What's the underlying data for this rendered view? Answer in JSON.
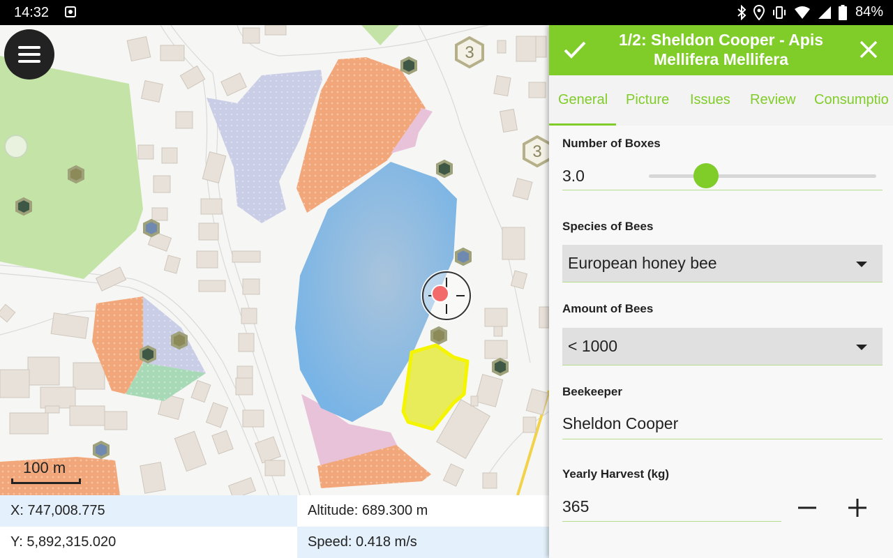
{
  "status_bar": {
    "time": "14:32",
    "battery": "84%"
  },
  "map": {
    "cluster_counts": [
      "3",
      "3"
    ],
    "scale_label": "100 m",
    "coordinates": {
      "x": "X: 747,008.775",
      "y": "Y: 5,892,315.020",
      "altitude": "Altitude: 689.300 m",
      "speed": "Speed: 0.418 m/s"
    }
  },
  "form": {
    "title": "1/2: Sheldon Cooper - Apis Mellifera Mellifera",
    "tabs": [
      "General",
      "Picture",
      "Issues",
      "Review",
      "Consumptio"
    ],
    "active_tab": "General",
    "number_of_boxes": {
      "label": "Number of Boxes",
      "value": "3.0",
      "slider_fraction": 0.25
    },
    "species": {
      "label": "Species of Bees",
      "value": "European honey bee"
    },
    "amount": {
      "label": "Amount of Bees",
      "value": "< 1000"
    },
    "beekeeper": {
      "label": "Beekeeper",
      "value": "Sheldon Cooper"
    },
    "harvest": {
      "label": "Yearly Harvest (kg)",
      "value": "365"
    }
  },
  "colors": {
    "accent": "#80cc28",
    "water": "#7fb8e4",
    "apiary_orange": "#f2a77a",
    "apiary_lavender": "#c9cde6",
    "apiary_pink": "#e8c2d8",
    "apiary_mint": "#a7d9b7",
    "selected_yellow": "#e8ec5a",
    "park_green": "#c4e4a7"
  }
}
